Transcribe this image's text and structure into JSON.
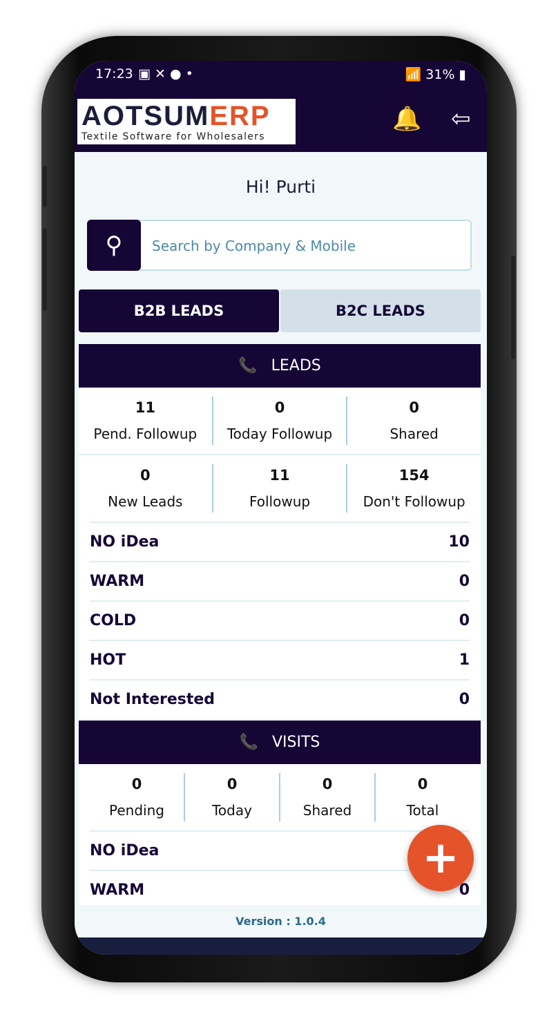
{
  "status_bar": {
    "time": "17:23",
    "battery": "31%"
  },
  "header": {
    "logo_main": "AOTSUM",
    "logo_accent": "ERP",
    "logo_tagline": "Textile Software for Wholesalers"
  },
  "greeting": "Hi! Purti",
  "search": {
    "placeholder": "Search by Company & Mobile"
  },
  "tabs": [
    {
      "label": "B2B LEADS",
      "active": true
    },
    {
      "label": "B2C LEADS",
      "active": false
    }
  ],
  "leads": {
    "title": "LEADS",
    "stats1": [
      {
        "value": "11",
        "label": "Pend. Followup"
      },
      {
        "value": "0",
        "label": "Today Followup"
      },
      {
        "value": "0",
        "label": "Shared"
      }
    ],
    "stats2": [
      {
        "value": "0",
        "label": "New Leads"
      },
      {
        "value": "11",
        "label": "Followup"
      },
      {
        "value": "154",
        "label": "Don't Followup"
      }
    ],
    "rows": [
      {
        "label": "NO iDea",
        "value": "10"
      },
      {
        "label": "WARM",
        "value": "0"
      },
      {
        "label": "COLD",
        "value": "0"
      },
      {
        "label": "HOT",
        "value": "1"
      },
      {
        "label": "Not Interested",
        "value": "0"
      }
    ]
  },
  "visits": {
    "title": "VISITS",
    "stats": [
      {
        "value": "0",
        "label": "Pending"
      },
      {
        "value": "0",
        "label": "Today"
      },
      {
        "value": "0",
        "label": "Shared"
      },
      {
        "value": "0",
        "label": "Total"
      }
    ],
    "rows": [
      {
        "label": "NO iDea",
        "value": ""
      },
      {
        "label": "WARM",
        "value": "0"
      }
    ]
  },
  "version": "Version : 1.0.4",
  "colors": {
    "primary": "#150636",
    "accent": "#e4532a",
    "tab_inactive": "#d3e0e8"
  }
}
